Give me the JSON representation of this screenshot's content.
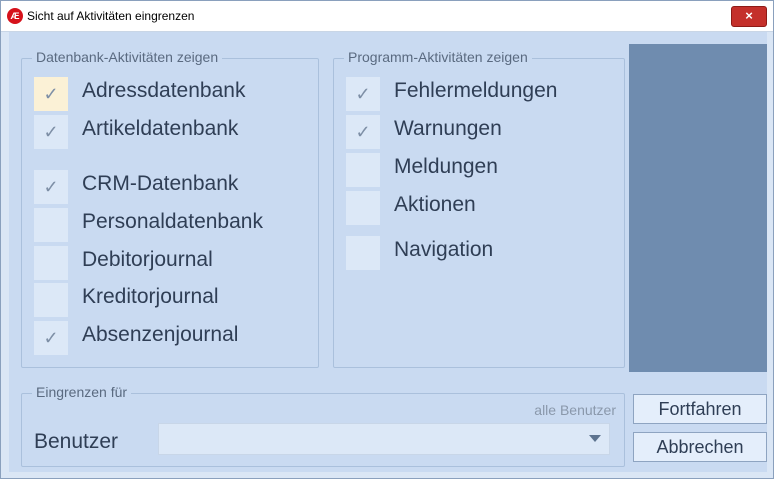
{
  "window": {
    "title": "Sicht auf Aktivitäten eingrenzen",
    "close": "×",
    "app_icon": "Æ"
  },
  "db_group": {
    "legend": "Datenbank-Aktivitäten zeigen",
    "items": [
      {
        "label": "Adressdatenbank",
        "checked": true,
        "mark": "✓"
      },
      {
        "label": "Artikeldatenbank",
        "checked": true,
        "mark": "✓"
      },
      {
        "label": "CRM-Datenbank",
        "checked": true,
        "mark": "✓"
      },
      {
        "label": "Personaldatenbank",
        "checked": false,
        "mark": ""
      },
      {
        "label": "Debitorjournal",
        "checked": false,
        "mark": ""
      },
      {
        "label": "Kreditorjournal",
        "checked": false,
        "mark": ""
      },
      {
        "label": "Absenzenjournal",
        "checked": true,
        "mark": "✓"
      }
    ]
  },
  "prog_group": {
    "legend": "Programm-Aktivitäten zeigen",
    "items": [
      {
        "label": "Fehlermeldungen",
        "checked": true,
        "mark": "✓"
      },
      {
        "label": "Warnungen",
        "checked": true,
        "mark": "✓"
      },
      {
        "label": "Meldungen",
        "checked": false,
        "mark": ""
      },
      {
        "label": "Aktionen",
        "checked": false,
        "mark": ""
      },
      {
        "label": "Navigation",
        "checked": false,
        "mark": ""
      }
    ]
  },
  "filter_group": {
    "legend": "Eingrenzen für",
    "hint": "alle Benutzer",
    "user_label": "Benutzer",
    "user_value": ""
  },
  "buttons": {
    "continue": "Fortfahren",
    "cancel": "Abbrechen"
  },
  "colors": {
    "side_panel": "#6f8caf",
    "close_button": "#c4302b",
    "selected_checkbox": "#fbf1d6"
  }
}
